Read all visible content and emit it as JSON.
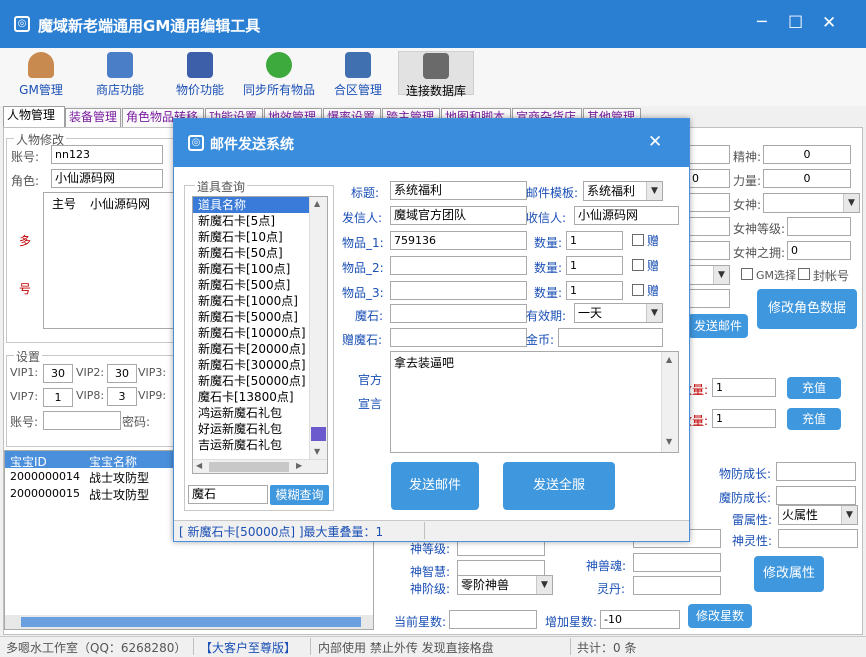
{
  "window": {
    "title": "魔域新老端通用GM通用编辑工具",
    "min": "─",
    "max": "☐",
    "close": "✕"
  },
  "toolbar": [
    {
      "label": "GM管理",
      "icon": "user-icon",
      "color": "#8a5a30"
    },
    {
      "label": "商店功能",
      "icon": "shop-icon",
      "color": "#4a7fc8"
    },
    {
      "label": "物价功能",
      "icon": "computer-icon",
      "color": "#3d5ea8"
    },
    {
      "label": "同步所有物品",
      "icon": "sync-icon",
      "color": "#3caa3c"
    },
    {
      "label": "合区管理",
      "icon": "server-icon",
      "color": "#4070b0"
    },
    {
      "label": "连接数据库",
      "icon": "database-icon",
      "color": "#6a6a6a"
    }
  ],
  "tabs": [
    "人物管理",
    "装备管理",
    "角色物品转移",
    "功能设置",
    "地效管理",
    "爆率设置",
    "跨主管理",
    "地图和脚本",
    "宣商杂货店",
    "其他管理"
  ],
  "char": {
    "group": "人物修改",
    "account_label": "账号:",
    "account": "nn123",
    "role_label": "角色:",
    "role": "小仙源码网",
    "col_master": "主号",
    "col_name": "小仙源码网",
    "duo": "多",
    "hao": "号"
  },
  "settings": {
    "group": "设置",
    "vip1_label": "VIP1:",
    "vip1": "30",
    "vip2_label": "VIP2:",
    "vip2": "30",
    "vip3_label": "VIP3:",
    "vip7_label": "VIP7:",
    "vip7": "1",
    "vip8_label": "VIP8:",
    "vip8": "3",
    "vip9_label": "VIP9:",
    "acct_label": "账号:",
    "pwd_label": "密码:"
  },
  "pet_table": {
    "col_id": "宝宝ID",
    "col_name": "宝宝名称",
    "rows": [
      {
        "id": "2000000014",
        "name": "战士攻防型"
      },
      {
        "id": "2000000015",
        "name": "战士攻防型"
      }
    ]
  },
  "right": {
    "spirit_label": "精神:",
    "spirit": "0",
    "power_label": "力量:",
    "power": "0",
    "power_left": "0",
    "goddess_label": "女神:",
    "goddess_level_label": "女神等级:",
    "goddess_own_label": "女神之拥:",
    "goddess_own": "0",
    "gm_select": "GM选择",
    "ban": "封帐号",
    "modify_role": "修改角色数据",
    "send_mail": "发送邮件",
    "qty_label": "数量:",
    "qty1": "1",
    "qty2": "1",
    "recharge": "充值",
    "mdef_label": "物防成长:",
    "mgdef_label": "魔防成长:",
    "thunder_label": "雷属性:",
    "thunder": "火属性",
    "divine_soul_label": "神灵性:",
    "modify_attr": "修改属性"
  },
  "beast": {
    "level_label": "神等级:",
    "wisdom_label": "神智慧:",
    "stage_label": "神阶级:",
    "stage": "零阶神兽",
    "soul_label": "神兽魂:",
    "pill_label": "灵丹:",
    "cur_star_label": "当前星数:",
    "add_star_label": "增加星数:",
    "add_star": "-10",
    "modify_star": "修改星数"
  },
  "status": {
    "s1": "多嗯水工作室（QQ：6268280）",
    "s2": "【大客户至尊版】",
    "s3": "内部使用 禁止外传 发现直接格盘",
    "s4": "共计：0 条"
  },
  "dialog": {
    "title": "邮件发送系统",
    "close": "✕",
    "item_group": "道具查询",
    "list_header": "道具名称",
    "items": [
      "新魔石卡[5点]",
      "新魔石卡[10点]",
      "新魔石卡[50点]",
      "新魔石卡[100点]",
      "新魔石卡[500点]",
      "新魔石卡[1000点]",
      "新魔石卡[5000点]",
      "新魔石卡[10000点]",
      "新魔石卡[20000点]",
      "新魔石卡[30000点]",
      "新魔石卡[50000点]",
      "魔石卡[13800点]",
      "鸿运新魔石礼包",
      "好运新魔石礼包",
      "吉运新魔石礼包"
    ],
    "search_value": "魔石",
    "search_btn": "模糊查询",
    "subject_label": "标题:",
    "subject": "系统福利",
    "template_label": "邮件模板:",
    "template": "系统福利",
    "sender_label": "发信人:",
    "sender": "魔域官方团队",
    "receiver_label": "收信人:",
    "receiver": "小仙源码网",
    "item1_label": "物品_1:",
    "item1": "759136",
    "item2_label": "物品_2:",
    "item3_label": "物品_3:",
    "count_label": "数量:",
    "count1": "1",
    "count2": "1",
    "count3": "1",
    "gift": "赠",
    "stone_label": "魔石:",
    "valid_label": "有效期:",
    "valid": "一天",
    "gift_stone_label": "赠魔石:",
    "gold_label": "金币:",
    "official1": "官方",
    "official2": "宣言",
    "message": "拿去装逼吧",
    "send_btn": "发送邮件",
    "send_all_btn": "发送全服",
    "status": "[ 新魔石卡[50000点] ]最大重叠量：1"
  }
}
